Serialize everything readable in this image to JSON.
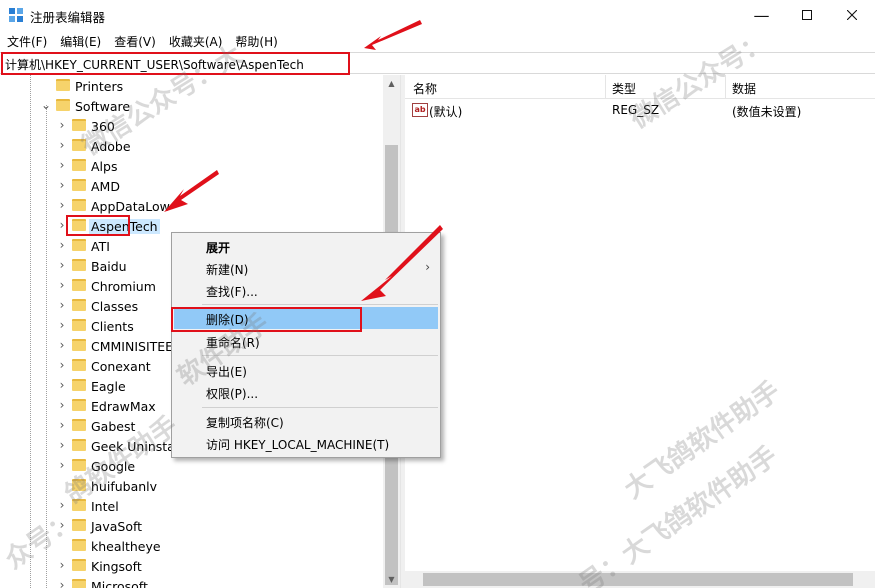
{
  "window": {
    "title": "注册表编辑器"
  },
  "menubar": [
    "文件(F)",
    "编辑(E)",
    "查看(V)",
    "收藏夹(A)",
    "帮助(H)"
  ],
  "address": {
    "path": "计算机\\HKEY_CURRENT_USER\\Software\\AspenTech"
  },
  "tree": {
    "parent_items": [
      {
        "label": "Printers",
        "expanded": false
      },
      {
        "label": "Software",
        "expanded": true
      }
    ],
    "children": [
      "360",
      "Adobe",
      "Alps",
      "AMD",
      "AppDataLow",
      "AspenTech",
      "ATI",
      "Baidu",
      "Chromium",
      "Classes",
      "Clients",
      "CMMINISITEE",
      "Conexant",
      "Eagle",
      "EdrawMax",
      "Gabest",
      "Geek Uninstal",
      "Google",
      "huifubanlv",
      "Intel",
      "JavaSoft",
      "khealtheye",
      "Kingsoft",
      "Microsoft"
    ],
    "selected": "AspenTech"
  },
  "list": {
    "headers": [
      "名称",
      "类型",
      "数据"
    ],
    "rows": [
      {
        "name": "(默认)",
        "type": "REG_SZ",
        "data": "(数值未设置)"
      }
    ]
  },
  "context_menu": {
    "items": [
      {
        "label": "展开",
        "bold": true
      },
      {
        "label": "新建(N)",
        "submenu": true
      },
      {
        "label": "查找(F)..."
      },
      {
        "label": "删除(D)",
        "highlighted": true
      },
      {
        "label": "重命名(R)"
      },
      {
        "label": "导出(E)"
      },
      {
        "label": "权限(P)..."
      },
      {
        "label": "复制项名称(C)"
      },
      {
        "label": "访问 HKEY_LOCAL_MACHINE(T)"
      }
    ]
  },
  "colors": {
    "annotation_red": "#e0101a",
    "highlight": "#91c9f7",
    "selection": "#cce8ff",
    "folder": "#f6d36b"
  },
  "icons": [
    "regedit-icon",
    "minimize-icon",
    "maximize-icon",
    "close-icon",
    "folder-icon",
    "chevron-right-icon",
    "chevron-down-icon",
    "string-value-icon"
  ],
  "watermarks": [
    "微信公众号：大",
    "微信公众号：",
    "大飞鸽软件助手",
    "软件助手",
    "鸽软件助手",
    "众号：",
    "号：大飞鸽软件助手"
  ]
}
